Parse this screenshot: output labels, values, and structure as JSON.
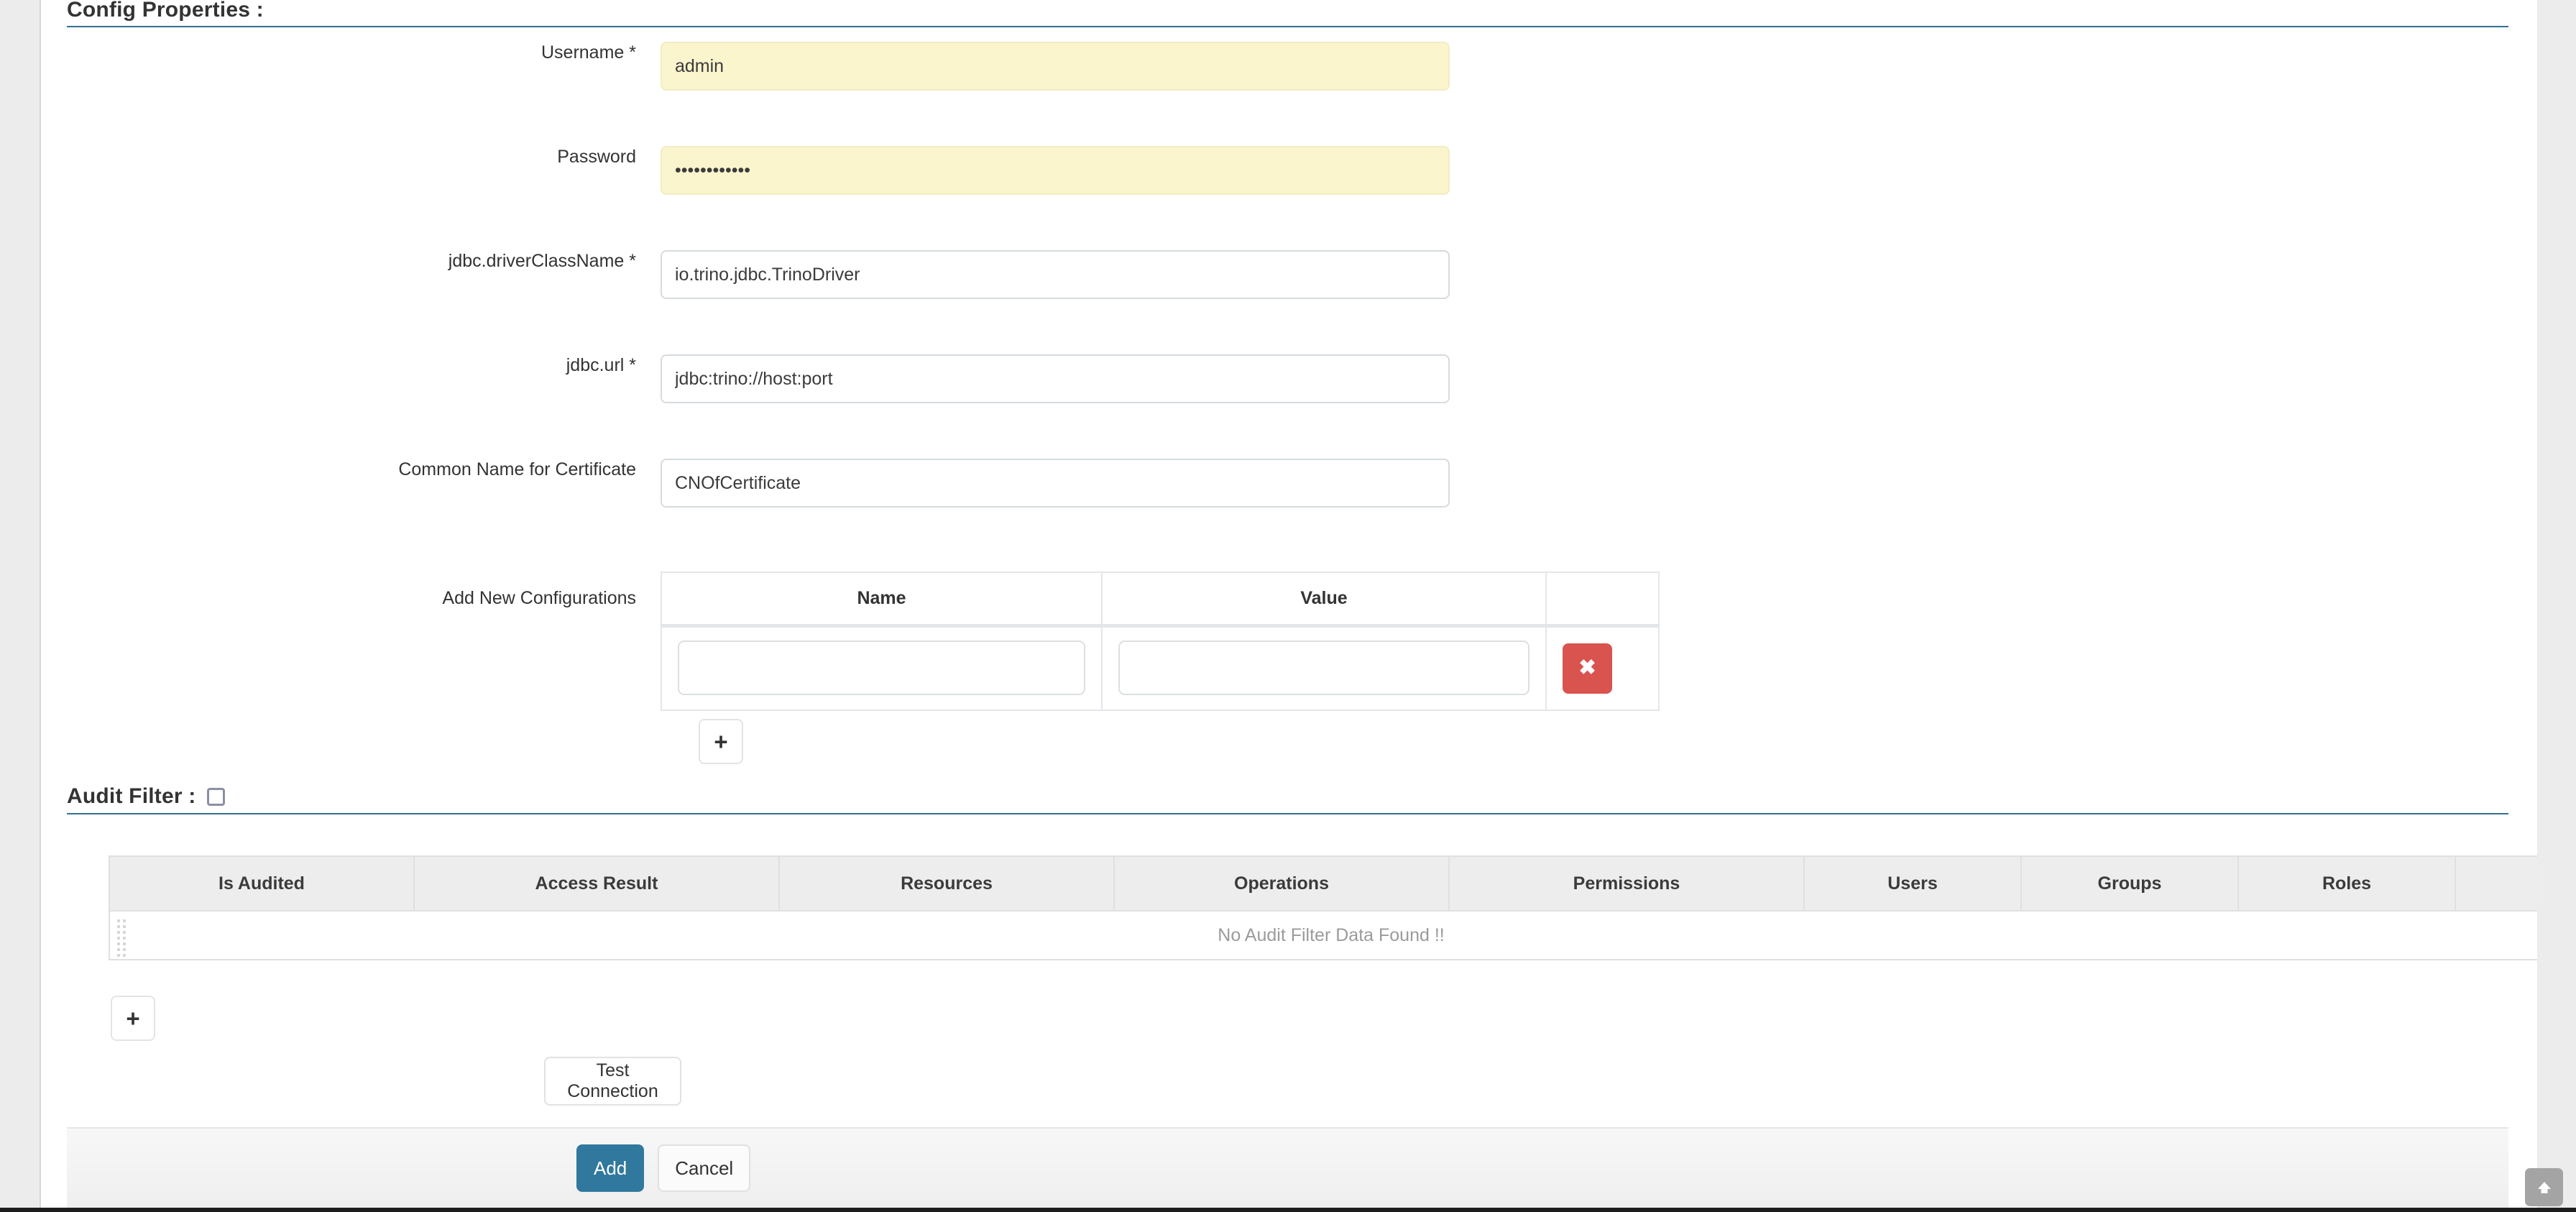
{
  "config_section": {
    "title": "Config Properties :",
    "fields": [
      {
        "label": "Username *",
        "value": "admin",
        "placeholder": "",
        "autofill": true,
        "name": "username"
      },
      {
        "label": "Password",
        "value": "••••••••••••",
        "placeholder": "",
        "autofill": true,
        "name": "password"
      },
      {
        "label": "jdbc.driverClassName *",
        "value": "io.trino.jdbc.TrinoDriver",
        "placeholder": "",
        "autofill": false,
        "name": "jdbc-driver-class-name"
      },
      {
        "label": "jdbc.url *",
        "value": "jdbc:trino://host:port",
        "placeholder": "",
        "autofill": false,
        "name": "jdbc-url"
      },
      {
        "label": "Common Name for Certificate",
        "value": "CNOfCertificate",
        "placeholder": "",
        "autofill": false,
        "name": "common-name-for-certificate"
      }
    ],
    "new_configs": {
      "label": "Add New Configurations",
      "columns": [
        "Name",
        "Value"
      ],
      "rows": [
        {
          "name_value": "",
          "value_value": "",
          "name_placeholder": "",
          "value_placeholder": "",
          "remove_label": "✖"
        }
      ],
      "add_row_label": "+"
    }
  },
  "audit_section": {
    "title": "Audit Filter :",
    "checkbox_checked": false,
    "columns": [
      "Is Audited",
      "Access Result",
      "Resources",
      "Operations",
      "Permissions",
      "Users",
      "Groups",
      "Roles",
      ""
    ],
    "empty_message": "No Audit Filter Data Found !!",
    "add_row_label": "+"
  },
  "actions": {
    "test_connection_label": "Test Connection",
    "submit_label": "Add",
    "cancel_label": "Cancel"
  },
  "scroll_top": {
    "icon": "arrow-up-icon"
  },
  "colors": {
    "accent_rule": "#33728e",
    "primary_button": "#31789e",
    "danger_button": "#d9534f",
    "autofill_background": "#fbf5cd",
    "header_background": "#ededed"
  }
}
